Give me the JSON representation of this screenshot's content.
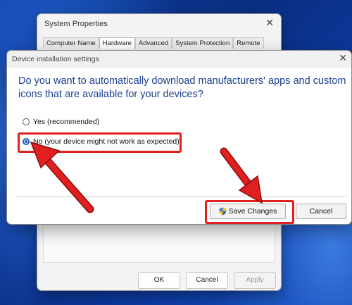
{
  "system_properties": {
    "title": "System Properties",
    "tabs": [
      "Computer Name",
      "Hardware",
      "Advanced",
      "System Protection",
      "Remote"
    ],
    "active_tab": "Hardware",
    "buttons": {
      "ok": "OK",
      "cancel": "Cancel",
      "apply": "Apply"
    }
  },
  "dialog": {
    "title": "Device installation settings",
    "question": "Do you want to automatically download manufacturers' apps and custom icons that are available for your devices?",
    "options": [
      {
        "label": "Yes (recommended)",
        "selected": false
      },
      {
        "label": "No (your device might not work as expected)",
        "selected": true
      }
    ],
    "save_label": "Save Changes",
    "cancel_label": "Cancel"
  },
  "icons": {
    "close": "close-icon",
    "shield": "uac-shield-icon"
  },
  "colors": {
    "highlight": "#e01f1f",
    "question_text": "#1a3f8f",
    "radio_selected": "#1f5fbf"
  }
}
